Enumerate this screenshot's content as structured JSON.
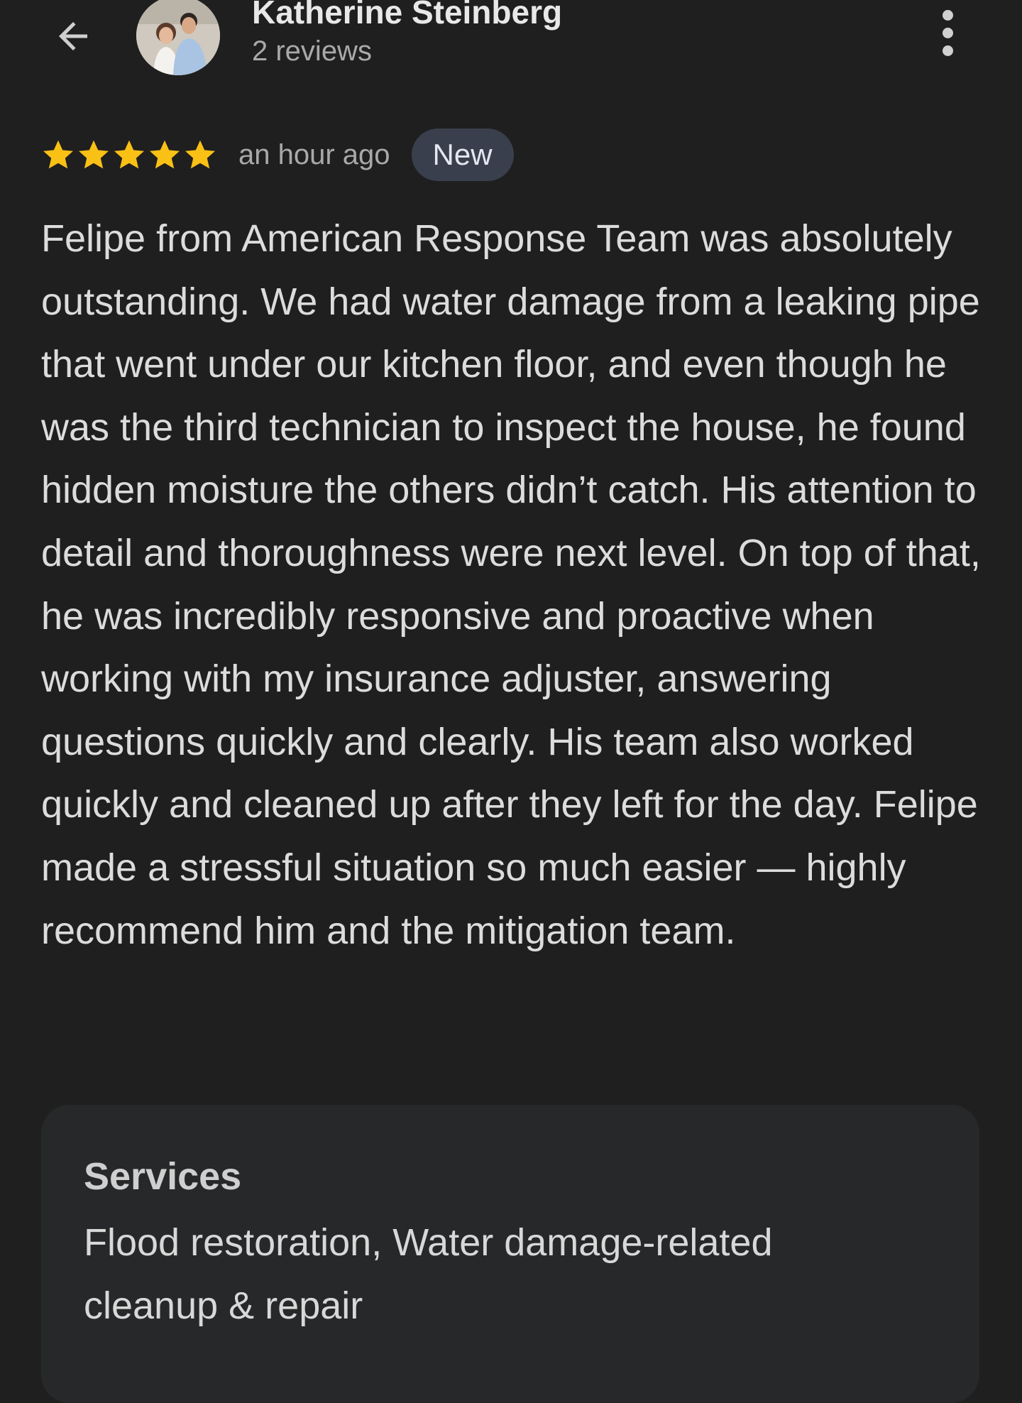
{
  "header": {
    "reviewer_name": "Katherine Steinberg",
    "review_count": "2 reviews",
    "back_icon": "arrow-back-icon",
    "more_icon": "more-vertical-icon"
  },
  "review": {
    "rating": 5,
    "rating_max": 5,
    "star_color": "#f9c016",
    "time_ago": "an hour ago",
    "badge": "New",
    "text": "Felipe from American Response Team was absolutely outstanding. We had water damage from a leaking pipe that went under our kitchen floor, and even though he was the third technician to inspect the house, he found hidden moisture the others didn’t catch. His attention to detail and thoroughness were next level. On top of that, he was incredibly responsive and proactive when working with my insurance adjuster, answering questions quickly and clearly. His team also worked quickly and cleaned up after they left for the day. Felipe made a stressful situation so much easier — highly recommend him and the mitigation team."
  },
  "services": {
    "title": "Services",
    "text": "Flood restoration, Water damage-related cleanup & repair"
  }
}
